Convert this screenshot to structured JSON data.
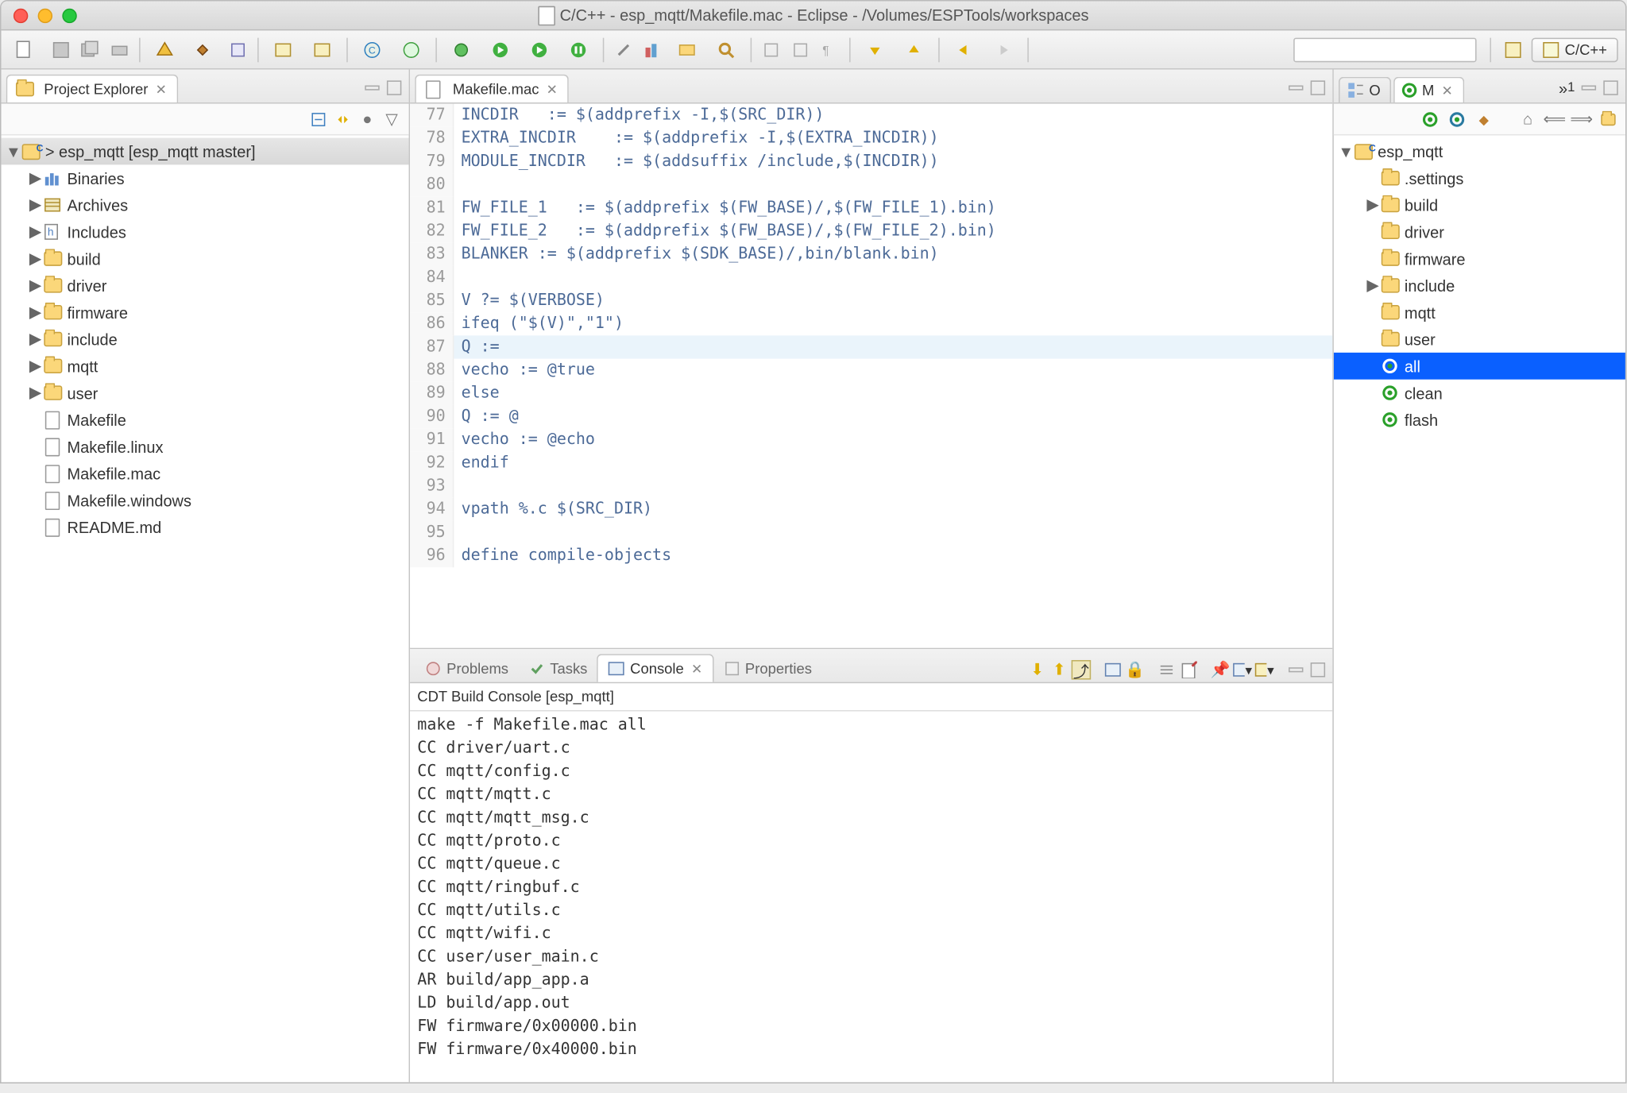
{
  "window": {
    "title": "C/C++ - esp_mqtt/Makefile.mac - Eclipse - /Volumes/ESPTools/workspaces"
  },
  "perspective": {
    "label": "C/C++"
  },
  "projectExplorer": {
    "title": "Project Explorer",
    "root": {
      "label": "> esp_mqtt  [esp_mqtt master]",
      "children": [
        {
          "label": "Binaries",
          "icon": "bin"
        },
        {
          "label": "Archives",
          "icon": "arch"
        },
        {
          "label": "Includes",
          "icon": "inc"
        },
        {
          "label": "build",
          "icon": "folder"
        },
        {
          "label": "driver",
          "icon": "folder"
        },
        {
          "label": "firmware",
          "icon": "folder"
        },
        {
          "label": "include",
          "icon": "folder"
        },
        {
          "label": "mqtt",
          "icon": "folder"
        },
        {
          "label": "user",
          "icon": "folder"
        },
        {
          "label": "Makefile",
          "icon": "file"
        },
        {
          "label": "Makefile.linux",
          "icon": "file"
        },
        {
          "label": "Makefile.mac",
          "icon": "file"
        },
        {
          "label": "Makefile.windows",
          "icon": "file"
        },
        {
          "label": "README.md",
          "icon": "file"
        }
      ]
    }
  },
  "editor": {
    "tab": "Makefile.mac",
    "highlightLine": 87,
    "lines": [
      {
        "n": 77,
        "t": "INCDIR   := $(addprefix -I,$(SRC_DIR))"
      },
      {
        "n": 78,
        "t": "EXTRA_INCDIR    := $(addprefix -I,$(EXTRA_INCDIR))"
      },
      {
        "n": 79,
        "t": "MODULE_INCDIR   := $(addsuffix /include,$(INCDIR))"
      },
      {
        "n": 80,
        "t": ""
      },
      {
        "n": 81,
        "t": "FW_FILE_1   := $(addprefix $(FW_BASE)/,$(FW_FILE_1).bin)"
      },
      {
        "n": 82,
        "t": "FW_FILE_2   := $(addprefix $(FW_BASE)/,$(FW_FILE_2).bin)"
      },
      {
        "n": 83,
        "t": "BLANKER := $(addprefix $(SDK_BASE)/,bin/blank.bin)"
      },
      {
        "n": 84,
        "t": ""
      },
      {
        "n": 85,
        "t": "V ?= $(VERBOSE)"
      },
      {
        "n": 86,
        "t": "ifeq (\"$(V)\",\"1\")"
      },
      {
        "n": 87,
        "t": "Q :="
      },
      {
        "n": 88,
        "t": "vecho := @true"
      },
      {
        "n": 89,
        "t": "else"
      },
      {
        "n": 90,
        "t": "Q := @"
      },
      {
        "n": 91,
        "t": "vecho := @echo"
      },
      {
        "n": 92,
        "t": "endif"
      },
      {
        "n": 93,
        "t": ""
      },
      {
        "n": 94,
        "t": "vpath %.c $(SRC_DIR)"
      },
      {
        "n": 95,
        "t": ""
      },
      {
        "n": 96,
        "t": "define compile-objects"
      }
    ]
  },
  "bottom": {
    "tabs": {
      "problems": "Problems",
      "tasks": "Tasks",
      "console": "Console",
      "properties": "Properties"
    },
    "consoleTitle": "CDT Build Console [esp_mqtt]",
    "consoleLines": [
      "make -f Makefile.mac all",
      "CC driver/uart.c",
      "CC mqtt/config.c",
      "CC mqtt/mqtt.c",
      "CC mqtt/mqtt_msg.c",
      "CC mqtt/proto.c",
      "CC mqtt/queue.c",
      "CC mqtt/ringbuf.c",
      "CC mqtt/utils.c",
      "CC mqtt/wifi.c",
      "CC user/user_main.c",
      "AR build/app_app.a",
      "LD build/app.out",
      "FW firmware/0x00000.bin",
      "FW firmware/0x40000.bin"
    ]
  },
  "right": {
    "tabs": {
      "outline": "O",
      "maketargets": "M"
    },
    "overflow": "»",
    "overflowCount": "1",
    "rootLabel": "esp_mqtt",
    "items": [
      {
        "label": ".settings",
        "type": "folder",
        "expandable": false
      },
      {
        "label": "build",
        "type": "folder",
        "expandable": true
      },
      {
        "label": "driver",
        "type": "folder",
        "expandable": false
      },
      {
        "label": "firmware",
        "type": "folder",
        "expandable": false
      },
      {
        "label": "include",
        "type": "folder",
        "expandable": true
      },
      {
        "label": "mqtt",
        "type": "folder",
        "expandable": false
      },
      {
        "label": "user",
        "type": "folder",
        "expandable": false
      },
      {
        "label": "all",
        "type": "target",
        "selected": true
      },
      {
        "label": "clean",
        "type": "target"
      },
      {
        "label": "flash",
        "type": "target"
      }
    ]
  }
}
